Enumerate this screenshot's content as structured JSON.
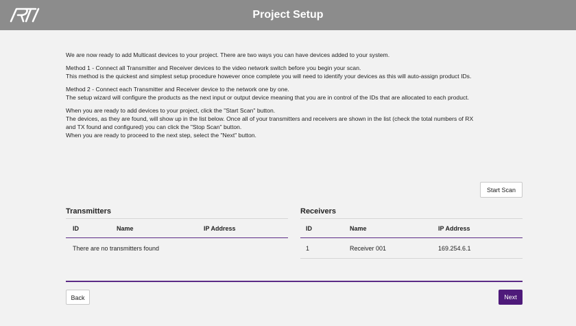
{
  "header": {
    "title": "Project Setup",
    "logo_text": "RTI"
  },
  "intro": {
    "p1": "We are now ready to add Multicast devices to your project. There are two ways you can have devices added to your system.",
    "p2_l1": "Method 1 - Connect all Transmitter and Receiver devices to the video network switch before you begin your scan.",
    "p2_l2": "This method is the quickest and simplest setup procedure however once complete you will need to identify your devices as this will auto-assign product IDs.",
    "p3_l1": "Method 2 - Connect each Transmitter and Receiver device to the network one by one.",
    "p3_l2": "The setup wizard will configure the products as the next input or output device meaning that you are in control of the IDs that are allocated to each product.",
    "p4_l1": "When you are ready to add devices to your project, click the \"Start Scan\" button.",
    "p4_l2": "The devices, as they are found, will show up in the list below. Once all of your transmitters and receivers are shown in the list (check the total numbers of RX",
    "p4_l3": "and TX found and configured) you can click the \"Stop Scan\" button.",
    "p4_l4": "When you are ready to proceed to the next step, select the \"Next\" button."
  },
  "scan_button": "Start Scan",
  "transmitters": {
    "title": "Transmitters",
    "columns": [
      "ID",
      "Name",
      "IP Address"
    ],
    "empty_message": "There are no transmitters found"
  },
  "receivers": {
    "title": "Receivers",
    "columns": [
      "ID",
      "Name",
      "IP Address"
    ],
    "rows": [
      {
        "id": "1",
        "name": "Receiver 001",
        "ip": "169.254.6.1"
      }
    ]
  },
  "footer": {
    "back_label": "Back",
    "next_label": "Next"
  },
  "colors": {
    "header_bg": "#8c8c8c",
    "accent_purple": "#4e1a7a",
    "background": "#f2f2f2"
  }
}
